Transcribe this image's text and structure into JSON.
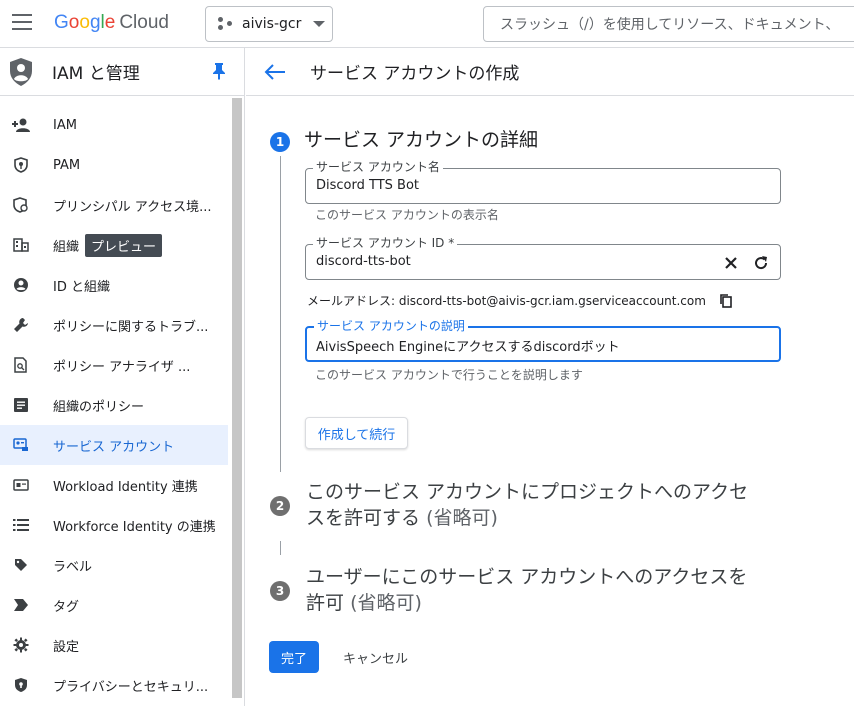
{
  "topbar": {
    "logo_letters": [
      "G",
      "o",
      "o",
      "g",
      "l",
      "e"
    ],
    "logo_suffix": "Cloud",
    "project_name": "aivis-gcr",
    "search_placeholder": "スラッシュ（/）を使用してリソース、ドキュメント、"
  },
  "sidebar": {
    "title": "IAM と管理",
    "items": [
      {
        "label": "IAM",
        "icon": "person-add-icon"
      },
      {
        "label": "PAM",
        "icon": "shield-key-icon"
      },
      {
        "label": "プリンシパル アクセス境...",
        "icon": "policy-icon"
      },
      {
        "label": "組織",
        "icon": "building-icon",
        "badge": "プレビュー"
      },
      {
        "label": "ID と組織",
        "icon": "account-circle-icon"
      },
      {
        "label": "ポリシーに関するトラブ...",
        "icon": "wrench-icon"
      },
      {
        "label": "ポリシー アナライザ ...",
        "icon": "document-search-icon"
      },
      {
        "label": "組織のポリシー",
        "icon": "list-document-icon"
      },
      {
        "label": "サービス アカウント",
        "icon": "service-account-icon",
        "active": true
      },
      {
        "label": "Workload Identity 連携",
        "icon": "id-card-icon"
      },
      {
        "label": "Workforce Identity の連携",
        "icon": "list-icon"
      },
      {
        "label": "ラベル",
        "icon": "label-icon"
      },
      {
        "label": "タグ",
        "icon": "tag-icon"
      },
      {
        "label": "設定",
        "icon": "gear-icon"
      },
      {
        "label": "プライバシーとセキュリ...",
        "icon": "privacy-shield-icon"
      }
    ]
  },
  "main": {
    "page_title": "サービス アカウントの作成",
    "step1": {
      "number": "1",
      "title": "サービス アカウントの詳細",
      "name_label": "サービス アカウント名",
      "name_value": "Discord TTS Bot",
      "name_hint": "このサービス アカウントの表示名",
      "id_label": "サービス アカウント ID *",
      "id_value": "discord-tts-bot",
      "email_label": "メールアドレス: discord-tts-bot@aivis-gcr.iam.gserviceaccount.com",
      "desc_label": "サービス アカウントの説明",
      "desc_value": "AivisSpeech Engineにアクセスするdiscordボット",
      "desc_hint": "このサービス アカウントで行うことを説明します",
      "continue_label": "作成して続行"
    },
    "step2": {
      "number": "2",
      "title_line1": "このサービス アカウントにプロジェクトへのアクセ",
      "title_line2": "スを許可する",
      "optional": "(省略可)"
    },
    "step3": {
      "number": "3",
      "title_line1": "ユーザーにこのサービス アカウントへのアクセスを",
      "title_line2": "許可",
      "optional": "(省略可)"
    },
    "done_label": "完了",
    "cancel_label": "キャンセル"
  },
  "colors": {
    "accent": "#1a73e8",
    "active_bg": "#e8f0fe"
  }
}
